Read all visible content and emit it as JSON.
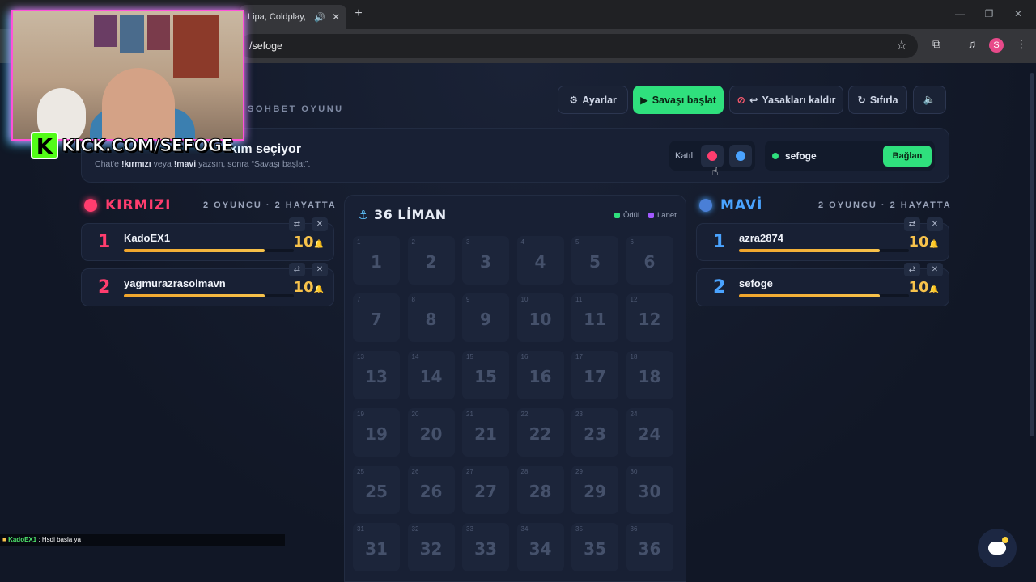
{
  "browser": {
    "tab_title": "Lipa, Coldplay, M",
    "url": "/sefoge",
    "profile_initial": "S"
  },
  "header": {
    "subtitle": "SOHBET OYUNU",
    "buttons": {
      "settings": "Ayarlar",
      "start": "Savaşı başlat",
      "unban": "Yasakları kaldır",
      "reset": "Sıfırla"
    }
  },
  "banner": {
    "title": "kım seçiyor",
    "sub_prefix": "Chat'e ",
    "cmd_red": "!kırmızı",
    "sub_mid": " veya ",
    "cmd_blue": "!mavi",
    "sub_suffix": " yazsın, sonra “Savaşı başlat”.",
    "join_label": "Katıl:",
    "channel": "sefoge",
    "connect": "Bağlan"
  },
  "teams": {
    "red": {
      "name": "KIRMIZI",
      "meta": "2 OYUNCU · 2 HAYATTA",
      "color": "#ff3d6e",
      "players": [
        {
          "rank": "1",
          "name": "KadoEX1",
          "lives": "10",
          "health": 0.83
        },
        {
          "rank": "2",
          "name": "yagmurazrasolmavn",
          "lives": "10",
          "health": 0.83
        }
      ]
    },
    "blue": {
      "name": "MAVİ",
      "meta": "2 OYUNCU · 2 HAYATTA",
      "color": "#4aa3ff",
      "players": [
        {
          "rank": "1",
          "name": "azra2874",
          "lives": "10",
          "health": 0.83
        },
        {
          "rank": "2",
          "name": "sefoge",
          "lives": "10",
          "health": 0.83
        }
      ]
    }
  },
  "board": {
    "title": "36 LİMAN",
    "legend_reward": "Ödül",
    "legend_curse": "Lanet",
    "cells": [
      "1",
      "2",
      "3",
      "4",
      "5",
      "6",
      "7",
      "8",
      "9",
      "10",
      "11",
      "12",
      "13",
      "14",
      "15",
      "16",
      "17",
      "18",
      "19",
      "20",
      "21",
      "22",
      "23",
      "24",
      "25",
      "26",
      "27",
      "28",
      "29",
      "30",
      "31",
      "32",
      "33",
      "34",
      "35",
      "36"
    ]
  },
  "overlay": {
    "kick_text": "KICK.COM/SEFOGE",
    "chat_user": "KadoEX1",
    "chat_msg": " : Hsdi basla ya"
  },
  "colors": {
    "accent": "#2fe07d",
    "gold": "#f7c24b",
    "reward": "#2fe07d",
    "curse": "#a259ff"
  }
}
